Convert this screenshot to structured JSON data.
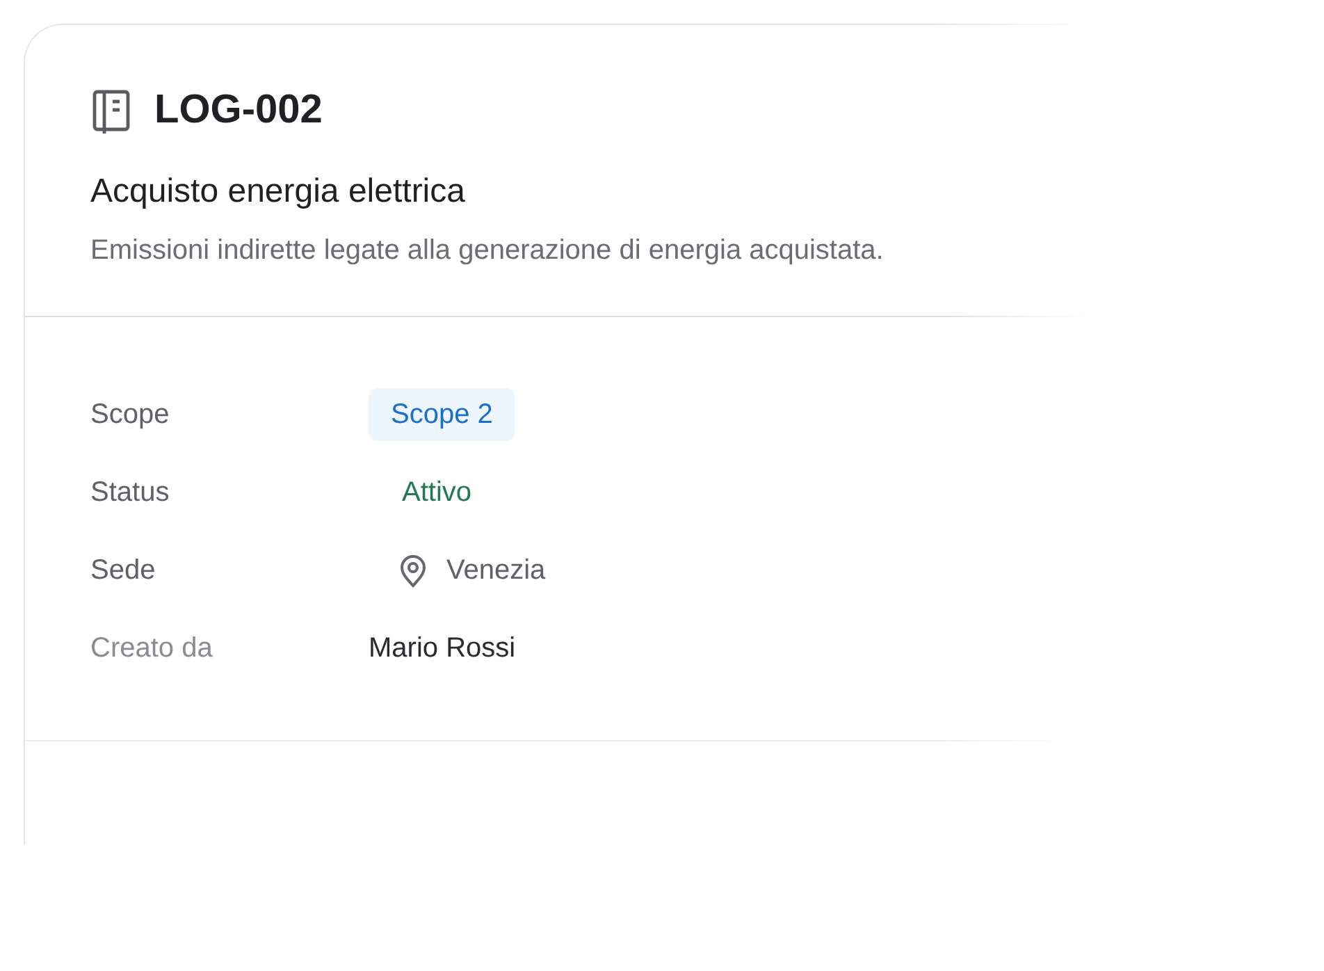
{
  "card": {
    "code": "LOG-002",
    "title": "Acquisto energia elettrica",
    "description": "Emissioni indirette legate alla generazione di energia acquistata.",
    "fields": [
      {
        "label": "Scope",
        "kind": "badge",
        "value": "Scope 2"
      },
      {
        "label": "Status",
        "kind": "status",
        "value": "Attivo"
      },
      {
        "label": "Sede",
        "kind": "location",
        "value": "Venezia"
      },
      {
        "label": "Creato da",
        "kind": "text",
        "value": "Mario Rossi"
      }
    ]
  }
}
